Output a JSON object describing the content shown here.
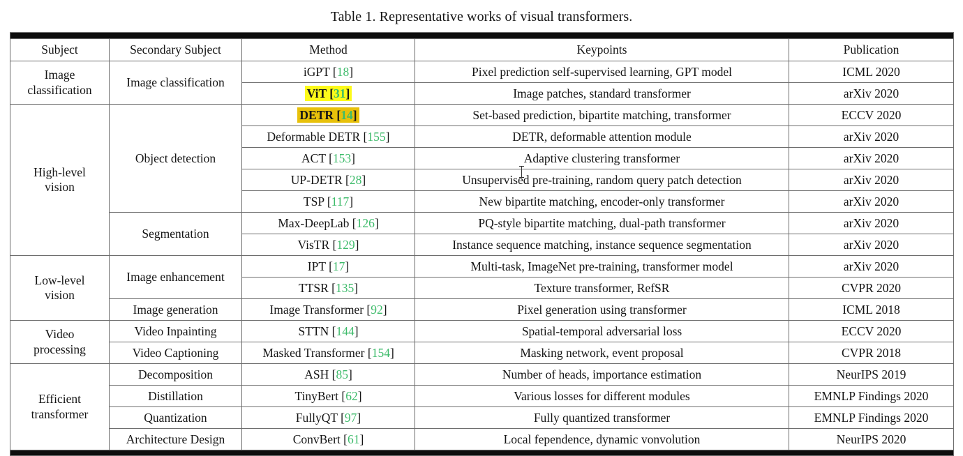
{
  "caption": "Table 1. Representative works of visual transformers.",
  "colors": {
    "citation_green": "#3dbb6a",
    "highlight_yellow": "#fdfa1a",
    "highlight_gold": "#e8c10a",
    "rule_black": "#0d0d0d",
    "grid_gray": "#6d6d6d",
    "text": "#151515"
  },
  "columns": [
    "Subject",
    "Secondary Subject",
    "Method",
    "Keypoints",
    "Publication"
  ],
  "subjects": [
    {
      "line1": "Image",
      "line2": "classification"
    },
    {
      "line1": "High-level",
      "line2": "vision"
    },
    {
      "line1": "Low-level",
      "line2": "vision"
    },
    {
      "line1": "Video",
      "line2": "processing"
    },
    {
      "line1": "Efficient",
      "line2": "transformer"
    }
  ],
  "secondary": [
    "Image classification",
    "Object detection",
    "Segmentation",
    "Image enhancement",
    "Image generation",
    "Video Inpainting",
    "Video Captioning",
    "Decomposition",
    "Distillation",
    "Quantization",
    "Architecture Design"
  ],
  "rows": [
    {
      "method_name": "iGPT",
      "method_cite": "18",
      "highlight": "none",
      "keypoints": "Pixel prediction self-supervised learning, GPT model",
      "publication": "ICML 2020"
    },
    {
      "method_name": "ViT",
      "method_cite": "31",
      "highlight": "yellow",
      "keypoints": "Image patches, standard transformer",
      "publication": "arXiv 2020"
    },
    {
      "method_name": "DETR",
      "method_cite": "14",
      "highlight": "gold",
      "keypoints": "Set-based prediction, bipartite matching, transformer",
      "publication": "ECCV 2020"
    },
    {
      "method_name": "Deformable DETR",
      "method_cite": "155",
      "highlight": "none",
      "keypoints": "DETR, deformable attention module",
      "publication": "arXiv 2020"
    },
    {
      "method_name": "ACT",
      "method_cite": "153",
      "highlight": "none",
      "keypoints": "Adaptive clustering transformer",
      "publication": "arXiv 2020"
    },
    {
      "method_name": "UP-DETR",
      "method_cite": "28",
      "highlight": "none",
      "keypoints": "Unsupervised pre-training, random query patch detection",
      "publication": "arXiv 2020"
    },
    {
      "method_name": "TSP",
      "method_cite": "117",
      "highlight": "none",
      "keypoints": "New bipartite matching, encoder-only transformer",
      "publication": "arXiv 2020"
    },
    {
      "method_name": "Max-DeepLab",
      "method_cite": "126",
      "highlight": "none",
      "keypoints": "PQ-style bipartite matching, dual-path transformer",
      "publication": "arXiv 2020"
    },
    {
      "method_name": "VisTR",
      "method_cite": "129",
      "highlight": "none",
      "keypoints": "Instance sequence matching, instance sequence segmentation",
      "publication": "arXiv 2020"
    },
    {
      "method_name": "IPT",
      "method_cite": "17",
      "highlight": "none",
      "keypoints": "Multi-task, ImageNet pre-training, transformer model",
      "publication": "arXiv 2020"
    },
    {
      "method_name": "TTSR",
      "method_cite": "135",
      "highlight": "none",
      "keypoints": "Texture transformer, RefSR",
      "publication": "CVPR 2020"
    },
    {
      "method_name": "Image Transformer",
      "method_cite": "92",
      "highlight": "none",
      "keypoints": "Pixel generation using transformer",
      "publication": "ICML 2018"
    },
    {
      "method_name": "STTN",
      "method_cite": "144",
      "highlight": "none",
      "keypoints": "Spatial-temporal adversarial loss",
      "publication": "ECCV 2020"
    },
    {
      "method_name": "Masked Transformer",
      "method_cite": "154",
      "highlight": "none",
      "keypoints": "Masking network, event proposal",
      "publication": "CVPR 2018"
    },
    {
      "method_name": "ASH",
      "method_cite": "85",
      "highlight": "none",
      "keypoints": "Number of heads, importance estimation",
      "publication": "NeurIPS 2019"
    },
    {
      "method_name": "TinyBert",
      "method_cite": "62",
      "highlight": "none",
      "keypoints": "Various losses for different modules",
      "publication": "EMNLP Findings 2020"
    },
    {
      "method_name": "FullyQT",
      "method_cite": "97",
      "highlight": "none",
      "keypoints": "Fully quantized transformer",
      "publication": "EMNLP Findings 2020"
    },
    {
      "method_name": "ConvBert",
      "method_cite": "61",
      "highlight": "none",
      "keypoints": "Local fependence, dynamic vonvolution",
      "publication": "NeurIPS 2020"
    }
  ]
}
